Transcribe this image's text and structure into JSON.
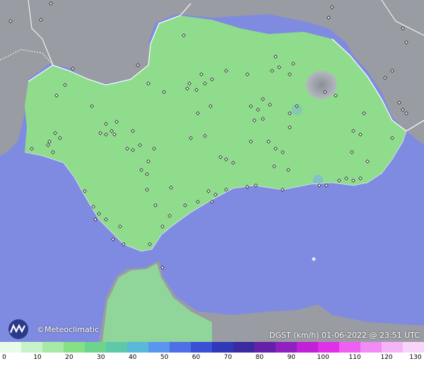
{
  "brand": {
    "name": "©Meteoclimatic",
    "logo_icon": "meteoclimatic-logo-icon"
  },
  "status": {
    "variable": "DGST (km/h)",
    "datetime": "01-06-2022 @ 23:51 UTC"
  },
  "colors": {
    "sea": "#7f8be0",
    "land_outside": "#9a9ca3",
    "region_fill": "#8fdc8c",
    "border": "#ffffff"
  },
  "colorbar": {
    "labels": [
      "0",
      "10",
      "20",
      "30",
      "40",
      "50",
      "60",
      "70",
      "80",
      "90",
      "100",
      "110",
      "120",
      "130"
    ],
    "colors": [
      "#e8fbe8",
      "#c8f3c8",
      "#a6eaa6",
      "#86e086",
      "#6cd48c",
      "#5ec8a8",
      "#58b8d8",
      "#5a96ee",
      "#4f6fe6",
      "#3b4fd6",
      "#2e38b8",
      "#3a2aa0",
      "#6420a8",
      "#9020c0",
      "#c020d8",
      "#e030e8",
      "#f060f0",
      "#f08cf4",
      "#f6b4f8",
      "#f9d4fa"
    ]
  }
}
